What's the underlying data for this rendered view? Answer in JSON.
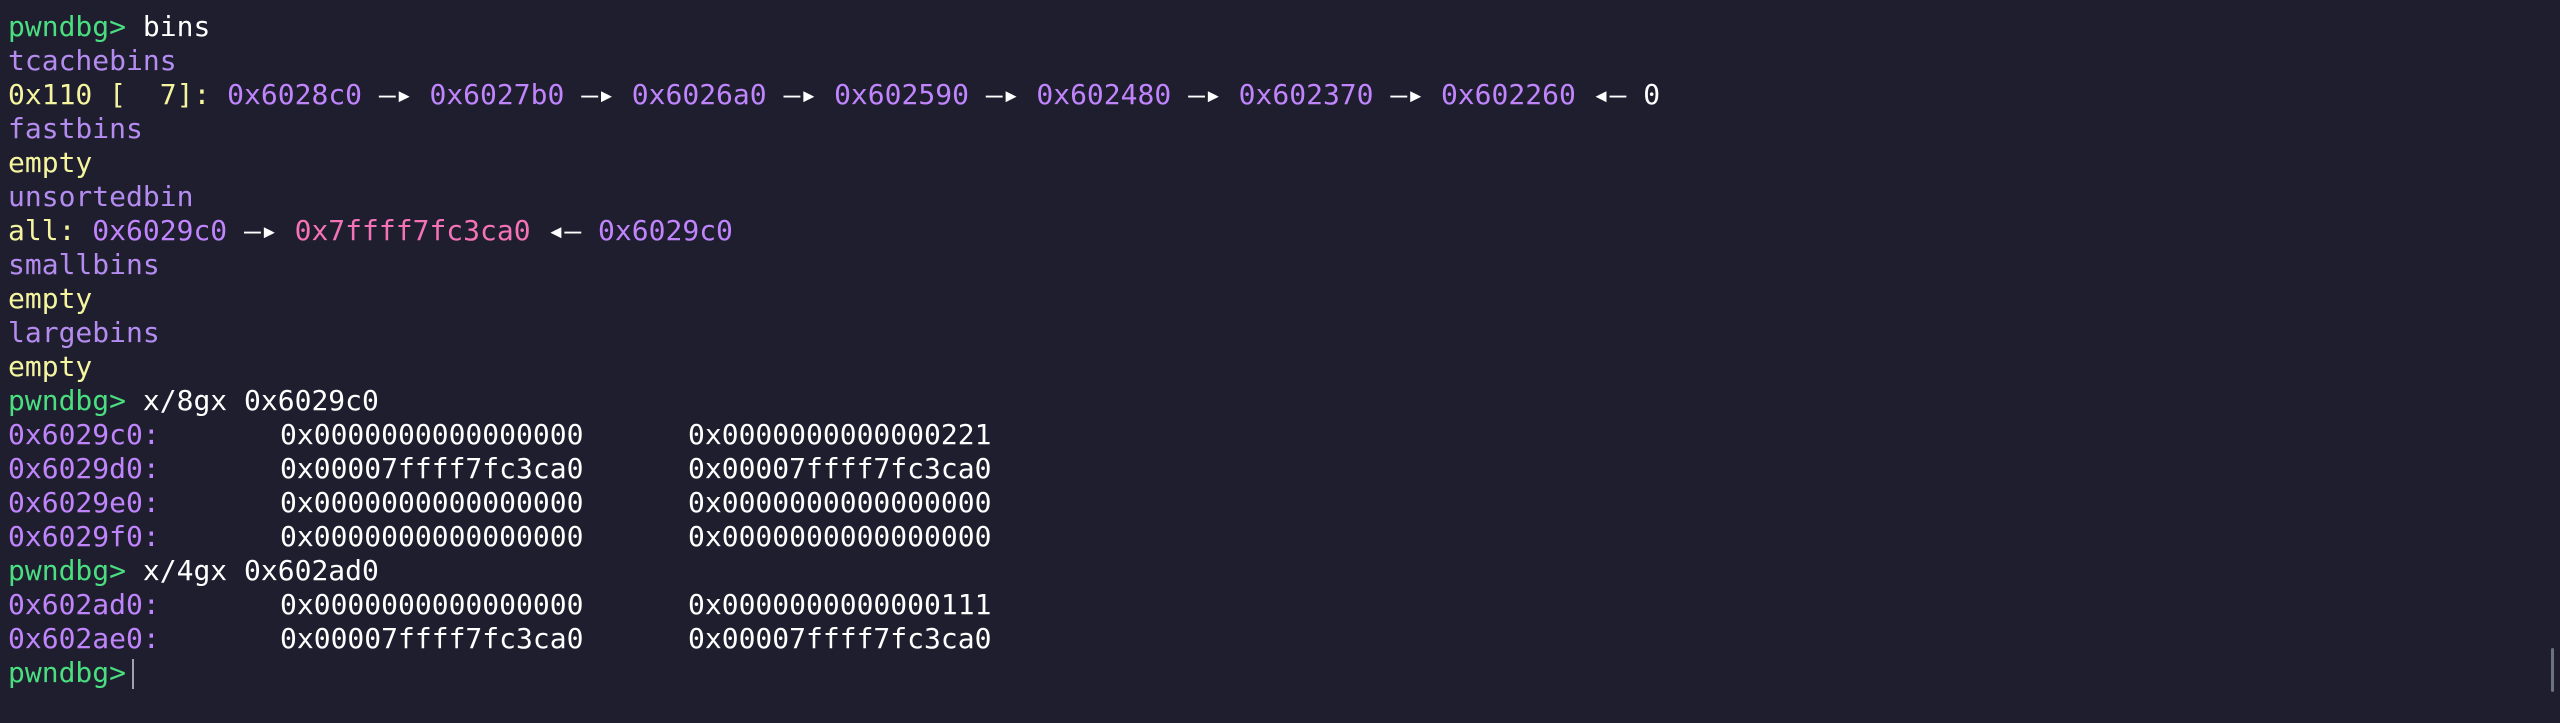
{
  "terminal": {
    "prompt": "pwndbg>",
    "cmd_bins": "bins",
    "tcachebins": "tcachebins",
    "tcache_size": "0x110",
    "tcache_count": "[  7]:",
    "tcache_chain": [
      "0x6028c0",
      "0x6027b0",
      "0x6026a0",
      "0x602590",
      "0x602480",
      "0x602370",
      "0x602260"
    ],
    "tcache_end": "0",
    "arrow": "—▸",
    "back_arrow": "◂—",
    "fastbins": "fastbins",
    "empty": "empty",
    "unsortedbin": "unsortedbin",
    "unsorted_all_label": "all:",
    "unsorted_a": "0x6029c0",
    "unsorted_b": "0x7ffff7fc3ca0",
    "unsorted_c": "0x6029c0",
    "smallbins": "smallbins",
    "largebins": "largebins",
    "cmd_x8": "x/8gx 0x6029c0",
    "mem1": [
      {
        "addr": "0x6029c0:",
        "v1": "0x0000000000000000",
        "v2": "0x0000000000000221"
      },
      {
        "addr": "0x6029d0:",
        "v1": "0x00007ffff7fc3ca0",
        "v2": "0x00007ffff7fc3ca0"
      },
      {
        "addr": "0x6029e0:",
        "v1": "0x0000000000000000",
        "v2": "0x0000000000000000"
      },
      {
        "addr": "0x6029f0:",
        "v1": "0x0000000000000000",
        "v2": "0x0000000000000000"
      }
    ],
    "cmd_x4": "x/4gx 0x602ad0",
    "mem2": [
      {
        "addr": "0x602ad0:",
        "v1": "0x0000000000000000",
        "v2": "0x0000000000000111"
      },
      {
        "addr": "0x602ae0:",
        "v1": "0x00007ffff7fc3ca0",
        "v2": "0x00007ffff7fc3ca0"
      }
    ]
  },
  "colors": {
    "background": "#1e1e2e",
    "prompt": "#4ade80",
    "section": "#b48cf0",
    "yellow": "#f5f5a0",
    "address": "#c084fc",
    "pink": "#f472b6"
  }
}
